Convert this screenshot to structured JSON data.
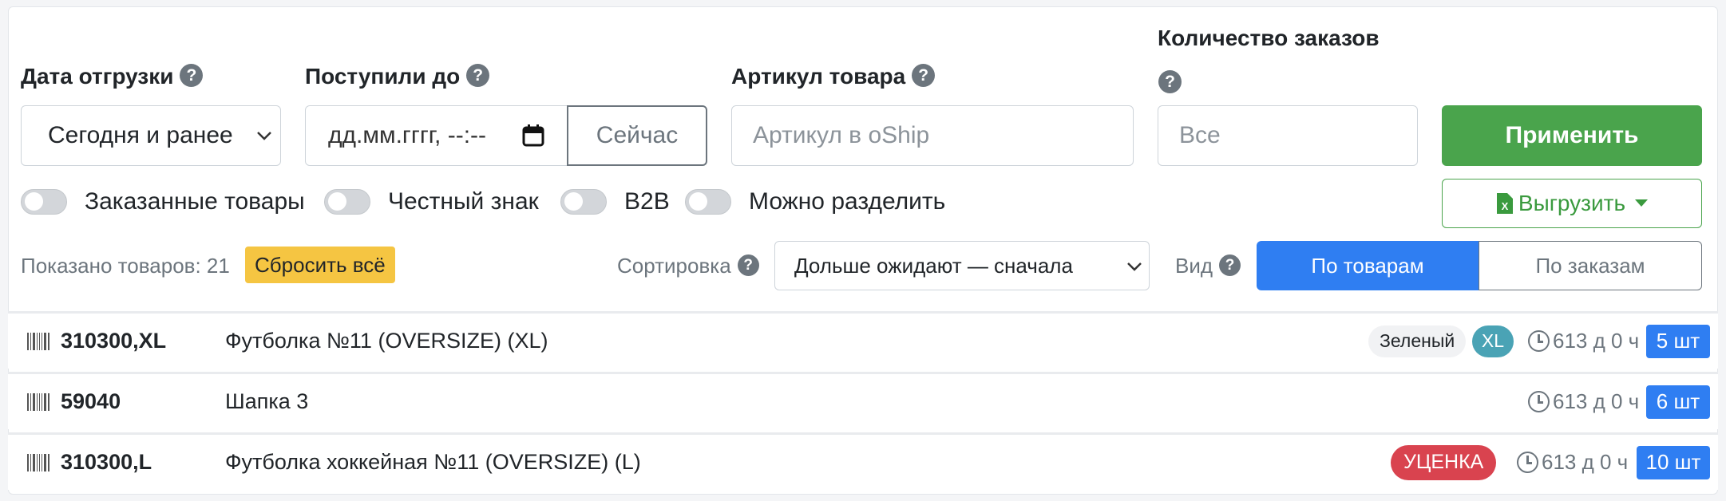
{
  "filters": {
    "ship_date_label": "Дата отгрузки",
    "ship_date_value": "Сегодня и ранее",
    "received_label": "Поступили до",
    "received_placeholder": "дд.мм.гггг, --:--",
    "now_button": "Сейчас",
    "sku_label": "Артикул товара",
    "sku_placeholder": "Артикул в oShip",
    "orders_label": "Количество заказов",
    "orders_placeholder": "Все",
    "apply_button": "Применить",
    "export_button": "Выгрузить"
  },
  "toggles": [
    {
      "label": "Заказанные товары",
      "on": false
    },
    {
      "label": "Честный знак",
      "on": false
    },
    {
      "label": "B2B",
      "on": false
    },
    {
      "label": "Можно разделить",
      "on": false
    }
  ],
  "summary": {
    "shown": "Показано товаров: 21",
    "reset_button": "Сбросить всё",
    "sort_label": "Сортировка",
    "sort_value": "Дольше ожидают — сначала",
    "view_label": "Вид",
    "view_by_items": "По товарам",
    "view_by_orders": "По заказам",
    "active_view": "По товарам"
  },
  "items": [
    {
      "sku": "310300,XL",
      "name": "Футболка №11 (OVERSIZE) (XL)",
      "color_tag": "Зеленый",
      "size_tag": "XL",
      "age": "613 д 0 ч",
      "qty": "5 шт"
    },
    {
      "sku": "59040",
      "name": "Шапка 3",
      "age": "613 д 0 ч",
      "qty": "6 шт"
    },
    {
      "sku": "310300,L",
      "name": "Футболка хоккейная №11 (OVERSIZE) (L)",
      "discount_tag": "УЦЕНКА",
      "age": "613 д 0 ч",
      "qty": "10 шт"
    }
  ],
  "colors": {
    "primary": "#2f7ef2",
    "success": "#4aa44c",
    "warning": "#f5c542",
    "danger": "#d9434f",
    "info": "#4aa3b5"
  }
}
